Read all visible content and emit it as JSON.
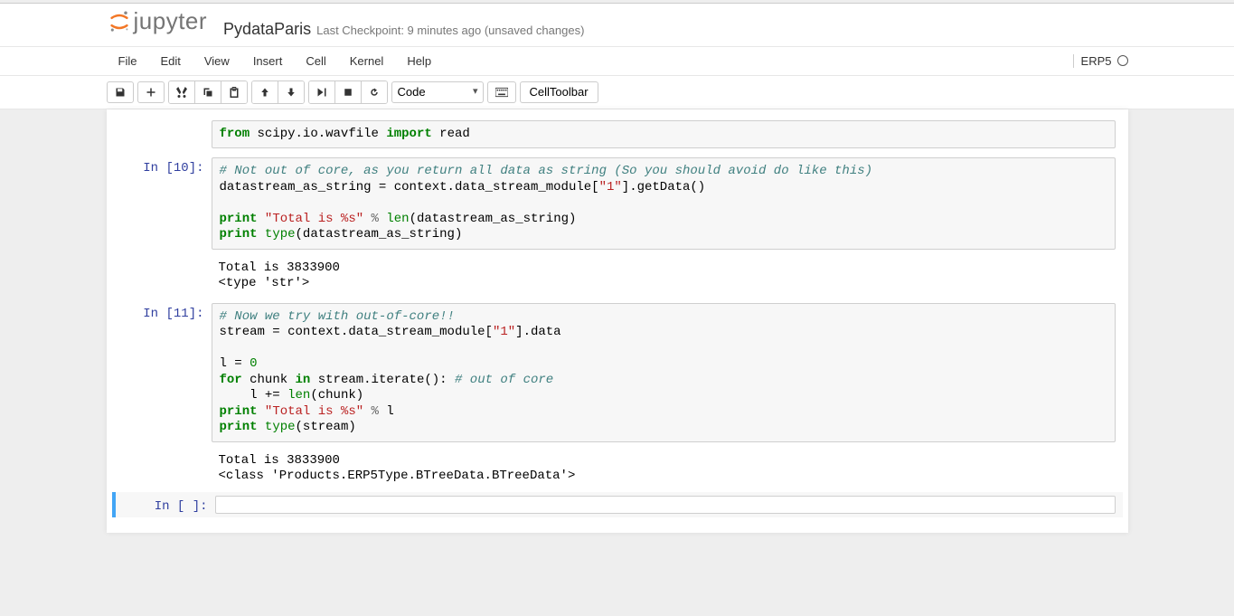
{
  "header": {
    "logo_text": "jupyter",
    "notebook_name": "PydataParis",
    "checkpoint": "Last Checkpoint: 9 minutes ago (unsaved changes)"
  },
  "menu": {
    "file": "File",
    "edit": "Edit",
    "view": "View",
    "insert": "Insert",
    "cell": "Cell",
    "kernel": "Kernel",
    "help": "Help"
  },
  "kernel_indicator": "ERP5",
  "toolbar": {
    "cell_type": "Code",
    "celltoolbar": "CellToolbar"
  },
  "cells": [
    {
      "prompt": "",
      "code_html": "<span class='kw-green'>from</span> scipy.io.wavfile <span class='kw-green'>import</span> read"
    },
    {
      "prompt": "In [10]:",
      "code_html": "<span class='comment'># Not out of core, as you return all data as string (So you should avoid do like this)</span>\ndatastream_as_string = context.data_stream_module[<span class='str-red'>\"1\"</span>].getData()\n\n<span class='kw-green'>print</span> <span class='str-red'>\"Total is %s\"</span> <span class='op'>%</span> <span class='builtin-green'>len</span>(datastream_as_string)\n<span class='kw-green'>print</span> <span class='builtin-green'>type</span>(datastream_as_string)",
      "output": "Total is 3833900\n<type 'str'>"
    },
    {
      "prompt": "In [11]:",
      "code_html": "<span class='comment'># Now we try with out-of-core!!</span>\nstream = context.data_stream_module[<span class='str-red'>\"1\"</span>].data\n\nl = <span class='num-green'>0</span>\n<span class='kw-green'>for</span> chunk <span class='kw-green'>in</span> stream.iterate(): <span class='comment'># out of core</span>\n    l += <span class='builtin-green'>len</span>(chunk)\n<span class='kw-green'>print</span> <span class='str-red'>\"Total is %s\"</span> <span class='op'>%</span> l\n<span class='kw-green'>print</span> <span class='builtin-green'>type</span>(stream)",
      "output": "Total is 3833900\n<class 'Products.ERP5Type.BTreeData.BTreeData'>"
    },
    {
      "prompt": "In [ ]:",
      "code_html": "",
      "selected": true
    }
  ]
}
